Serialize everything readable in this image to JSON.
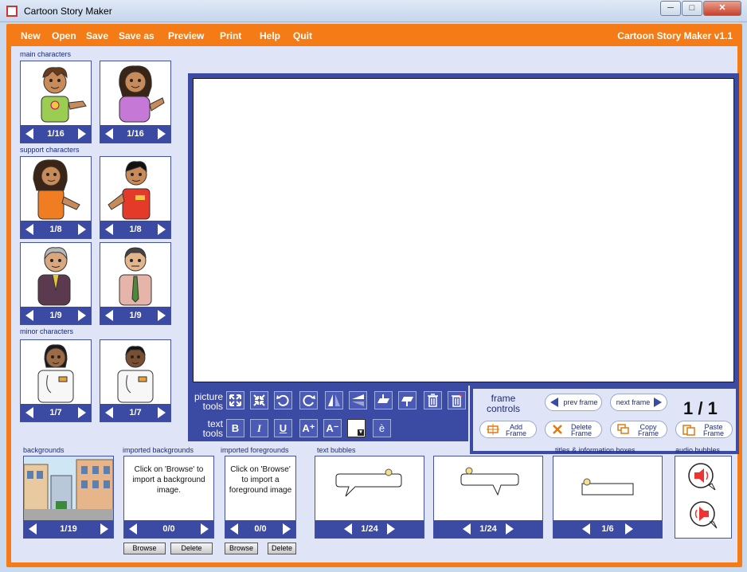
{
  "window": {
    "title": "Cartoon Story Maker",
    "minimize": "─",
    "maximize": "□",
    "close": "✕"
  },
  "menu": {
    "items": [
      "New",
      "Open",
      "Save",
      "Save as",
      "Preview",
      "Print",
      "Help",
      "Quit"
    ],
    "version": "Cartoon Story Maker v1.1"
  },
  "characters": {
    "main_label": "main characters",
    "support_label": "support characters",
    "minor_label": "minor characters",
    "cards": [
      {
        "count": "1/16",
        "desc": "boy-green-shirt"
      },
      {
        "count": "1/16",
        "desc": "woman-purple"
      },
      {
        "count": "1/8",
        "desc": "woman-orange"
      },
      {
        "count": "1/8",
        "desc": "boy-red-shirt"
      },
      {
        "count": "1/9",
        "desc": "grandmother"
      },
      {
        "count": "1/9",
        "desc": "man-pink-shirt"
      },
      {
        "count": "1/7",
        "desc": "doctor-female"
      },
      {
        "count": "1/7",
        "desc": "doctor-male"
      }
    ]
  },
  "tools": {
    "picture_label": "picture\ntools",
    "text_label": "text\ntools",
    "picture_icons": [
      "enlarge-icon",
      "shrink-icon",
      "rotate-left-icon",
      "rotate-right-icon",
      "flip-horizontal-icon",
      "flip-vertical-icon",
      "bring-forward-icon",
      "send-backward-icon",
      "delete-picture-icon",
      "delete-all-icon"
    ],
    "text_buttons": [
      {
        "name": "bold-button",
        "label": "B"
      },
      {
        "name": "italic-button",
        "label": "I"
      },
      {
        "name": "underline-button",
        "label": "U"
      },
      {
        "name": "increase-font-button",
        "label": "A⁺"
      },
      {
        "name": "decrease-font-button",
        "label": "A⁻"
      },
      {
        "name": "text-color-button",
        "label": ""
      },
      {
        "name": "special-char-button",
        "label": "è"
      }
    ]
  },
  "frame_controls": {
    "title": "frame controls",
    "prev": "prev frame",
    "next": "next frame",
    "counter": "1 / 1",
    "add": "Add Frame",
    "delete": "Delete Frame",
    "copy": "Copy Frame",
    "paste": "Paste Frame"
  },
  "bottom": {
    "backgrounds": {
      "label": "backgrounds",
      "count": "1/19"
    },
    "imported_backgrounds": {
      "label": "imported backgrounds",
      "message": "Click on 'Browse' to import a background image.",
      "count": "0/0",
      "browse": "Browse",
      "delete": "Delete"
    },
    "imported_foregrounds": {
      "label": "imported foregrounds",
      "message": "Click on 'Browse' to import a foreground image",
      "count": "0/0",
      "browse": "Browse",
      "delete": "Delete"
    },
    "text_bubbles": {
      "label": "text bubbles",
      "count1": "1/24",
      "count2": "1/24"
    },
    "titles": {
      "label": "titles & information boxes",
      "count": "1/6"
    },
    "audio": {
      "label": "audio bubbles"
    }
  },
  "colors": {
    "orange": "#f47b16",
    "navy": "#3b4aa3",
    "panel": "#dfe5f7"
  }
}
